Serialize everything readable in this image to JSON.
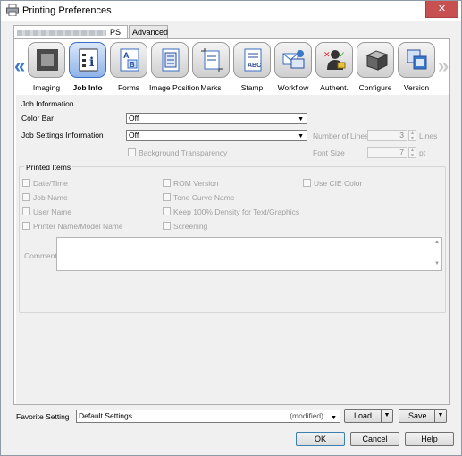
{
  "window": {
    "title": "Printing Preferences",
    "close_glyph": "✕"
  },
  "tabs": [
    {
      "label": "PS",
      "active": true
    },
    {
      "label": "Advanced",
      "active": false
    }
  ],
  "nav": {
    "left_arrow": "«",
    "right_arrow": "»"
  },
  "icon_tabs": [
    {
      "label": "Imaging",
      "icon": "imaging-icon",
      "active": false
    },
    {
      "label": "Job Info",
      "icon": "job-info-icon",
      "active": true
    },
    {
      "label": "Forms",
      "icon": "forms-icon",
      "active": false
    },
    {
      "label": "Image Position",
      "icon": "image-position-icon",
      "active": false
    },
    {
      "label": "Marks",
      "icon": "marks-icon",
      "active": false
    },
    {
      "label": "Stamp",
      "icon": "stamp-icon",
      "active": false
    },
    {
      "label": "Workflow",
      "icon": "workflow-icon",
      "active": false
    },
    {
      "label": "Authent.",
      "icon": "authentication-icon",
      "active": false
    },
    {
      "label": "Configure",
      "icon": "configure-icon",
      "active": false
    },
    {
      "label": "Version",
      "icon": "version-icon",
      "active": false
    }
  ],
  "job_information": {
    "title": "Job Information",
    "color_bar": {
      "label": "Color Bar",
      "value": "Off"
    },
    "job_settings": {
      "label": "Job Settings Information",
      "value": "Off"
    },
    "number_of_lines": {
      "label": "Number of Lines",
      "value": "3",
      "unit": "Lines"
    },
    "font_size": {
      "label": "Font Size",
      "value": "7",
      "unit": "pt"
    },
    "background_transparency": {
      "label": "Background Transparency",
      "checked": false
    }
  },
  "printed_items": {
    "title": "Printed Items",
    "items": [
      {
        "label": "Date/Time",
        "checked": false
      },
      {
        "label": "Job Name",
        "checked": false
      },
      {
        "label": "User Name",
        "checked": false
      },
      {
        "label": "Printer Name/Model Name",
        "checked": false
      },
      {
        "label": "ROM Version",
        "checked": false
      },
      {
        "label": "Tone Curve Name",
        "checked": false
      },
      {
        "label": "Keep 100% Density for Text/Graphics",
        "checked": false
      },
      {
        "label": "Screening",
        "checked": false
      },
      {
        "label": "Use CIE Color",
        "checked": false
      }
    ],
    "comment": {
      "label": "Comment",
      "value": ""
    }
  },
  "favorite": {
    "label": "Favorite Setting",
    "value": "Default Settings",
    "state": "(modified)",
    "load_label": "Load",
    "save_label": "Save"
  },
  "buttons": {
    "ok": "OK",
    "cancel": "Cancel",
    "help": "Help"
  }
}
